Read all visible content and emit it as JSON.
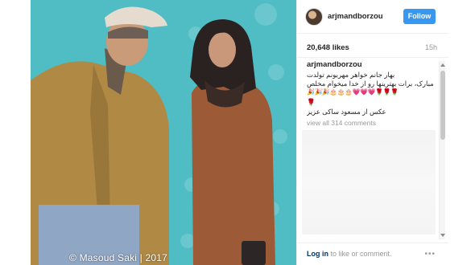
{
  "post": {
    "username": "arjmandborzou",
    "follow_label": "Follow",
    "likes": "20,648 likes",
    "time_ago": "15h",
    "caption_user": "arjmandborzou",
    "caption_lines": [
      "بهار جانم خواهر مهربونم تولدت",
      "مبارک، برات بهترینها رو از خدا میخوام مخلص",
      "🌹🌹🌹💗💗💗🎂🎂🎂🎉🎉🎉",
      "🌹",
      "عکس از مسعود ساکی عزیز"
    ],
    "view_all": "view all 314 comments",
    "login_link": "Log in",
    "login_rest": " to like or comment.",
    "more_icon": "more-icon"
  },
  "photo": {
    "credit": "© Masoud Saki | 2017",
    "background_color": "#4fbcc4"
  }
}
